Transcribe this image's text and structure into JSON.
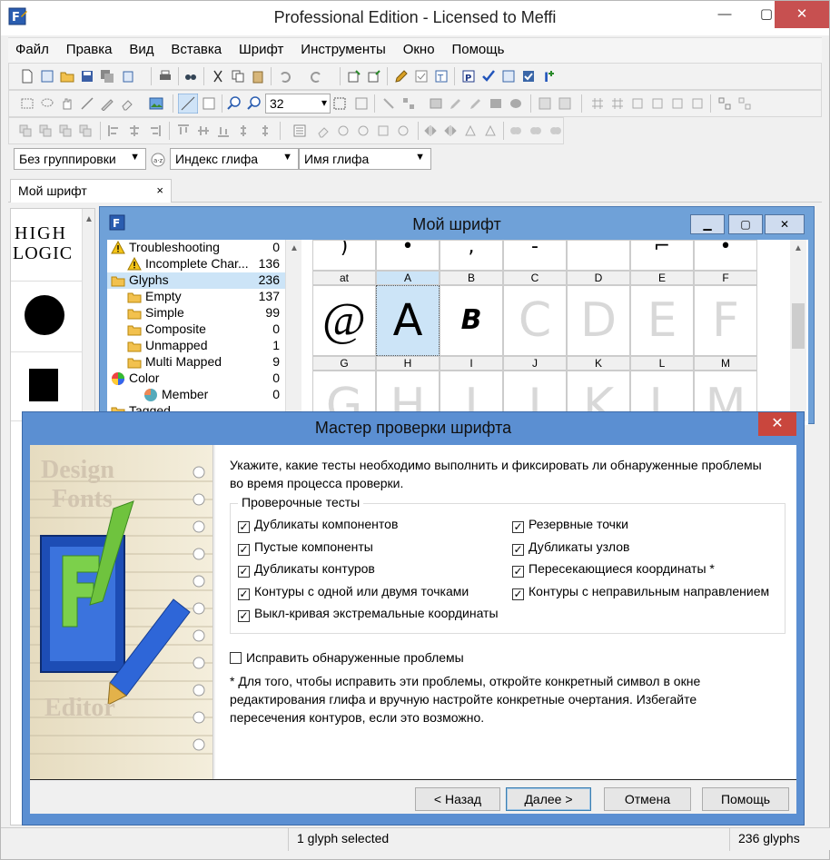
{
  "app": {
    "title": "Professional Edition - Licensed to Meffi",
    "window_min": "—",
    "window_max": "▢",
    "window_close": "✕"
  },
  "menu": [
    "Файл",
    "Правка",
    "Вид",
    "Вставка",
    "Шрифт",
    "Инструменты",
    "Окно",
    "Помощь"
  ],
  "toolbar": {
    "zoom_value": "32"
  },
  "filters": {
    "grouping": "Без группировки",
    "index": "Индекс глифа",
    "name": "Имя глифа"
  },
  "tab": {
    "label": "Мой шрифт",
    "close": "×"
  },
  "preview": {
    "logo_line1": "HIGH",
    "logo_line2": "LOGIC"
  },
  "font_window": {
    "title": "Мой шрифт",
    "tree": [
      {
        "label": "Troubleshooting",
        "count": "0",
        "icon": "warning-icon",
        "indent": 0
      },
      {
        "label": "Incomplete Char...",
        "count": "136",
        "icon": "warning-icon",
        "indent": 1
      },
      {
        "label": "Glyphs",
        "count": "236",
        "icon": "folder-icon",
        "indent": 0,
        "selected": true
      },
      {
        "label": "Empty",
        "count": "137",
        "icon": "folder-icon",
        "indent": 1
      },
      {
        "label": "Simple",
        "count": "99",
        "icon": "folder-icon",
        "indent": 1
      },
      {
        "label": "Composite",
        "count": "0",
        "icon": "folder-icon",
        "indent": 1
      },
      {
        "label": "Unmapped",
        "count": "1",
        "icon": "folder-icon",
        "indent": 1
      },
      {
        "label": "Multi Mapped",
        "count": "9",
        "icon": "folder-icon",
        "indent": 1
      },
      {
        "label": "Color",
        "count": "0",
        "icon": "color-icon",
        "indent": 0
      },
      {
        "label": "Member",
        "count": "0",
        "icon": "palette-icon",
        "indent": 2
      },
      {
        "label": "Tagged",
        "count": "",
        "icon": "folder-icon",
        "indent": 0
      }
    ],
    "grid_row1_heads": [
      "at",
      "A",
      "B",
      "C",
      "D",
      "E",
      "F"
    ],
    "grid_row1_glyphs": [
      "@",
      "A",
      "B",
      "C",
      "D",
      "E",
      "F"
    ],
    "grid_row2_heads": [
      "G",
      "H",
      "I",
      "J",
      "K",
      "L",
      "M"
    ],
    "grid_row2_glyphs": [
      "G",
      "H",
      "I",
      "J",
      "K",
      "L",
      "M"
    ],
    "grid_row0_glyphs": [
      ")",
      "•",
      ",",
      "‐",
      "",
      "⌐",
      "•"
    ]
  },
  "dialog": {
    "title": "Мастер проверки шрифта",
    "close": "✕",
    "intro": "Укажите, какие тесты необходимо выполнить и фиксировать ли обнаруженные проблемы во время процесса проверки.",
    "group_label": "Проверочные тесты",
    "tests_left": [
      {
        "label": "Дубликаты компонентов",
        "checked": true
      },
      {
        "label": "Пустые компоненты",
        "checked": true
      },
      {
        "label": "Дубликаты контуров",
        "checked": true
      },
      {
        "label": "Контуры с одной или двумя точками",
        "checked": true
      },
      {
        "label": "Выкл-кривая экстремальные координаты",
        "checked": true
      }
    ],
    "tests_right": [
      {
        "label": "Резервные точки",
        "checked": true
      },
      {
        "label": "Дубликаты узлов",
        "checked": true
      },
      {
        "label": "Пересекающиеся координаты *",
        "checked": true
      },
      {
        "label": "Контуры с неправильным направлением",
        "checked": true
      }
    ],
    "fix_label": "Исправить обнаруженные проблемы",
    "fix_checked": false,
    "note": "* Для того, чтобы исправить эти проблемы, откройте конкретный символ в окне редактирования глифа и вручную настройте конкретные очертания. Избегайте пересечения контуров, если это возможно.",
    "art_text_1": "Design",
    "art_text_2": "Fonts",
    "art_text_3": "Editor",
    "buttons": {
      "back": "< Назад",
      "next": "Далее >",
      "cancel": "Отмена",
      "help": "Помощь"
    }
  },
  "status": {
    "selected": "1 glyph selected",
    "total": "236 glyphs"
  }
}
